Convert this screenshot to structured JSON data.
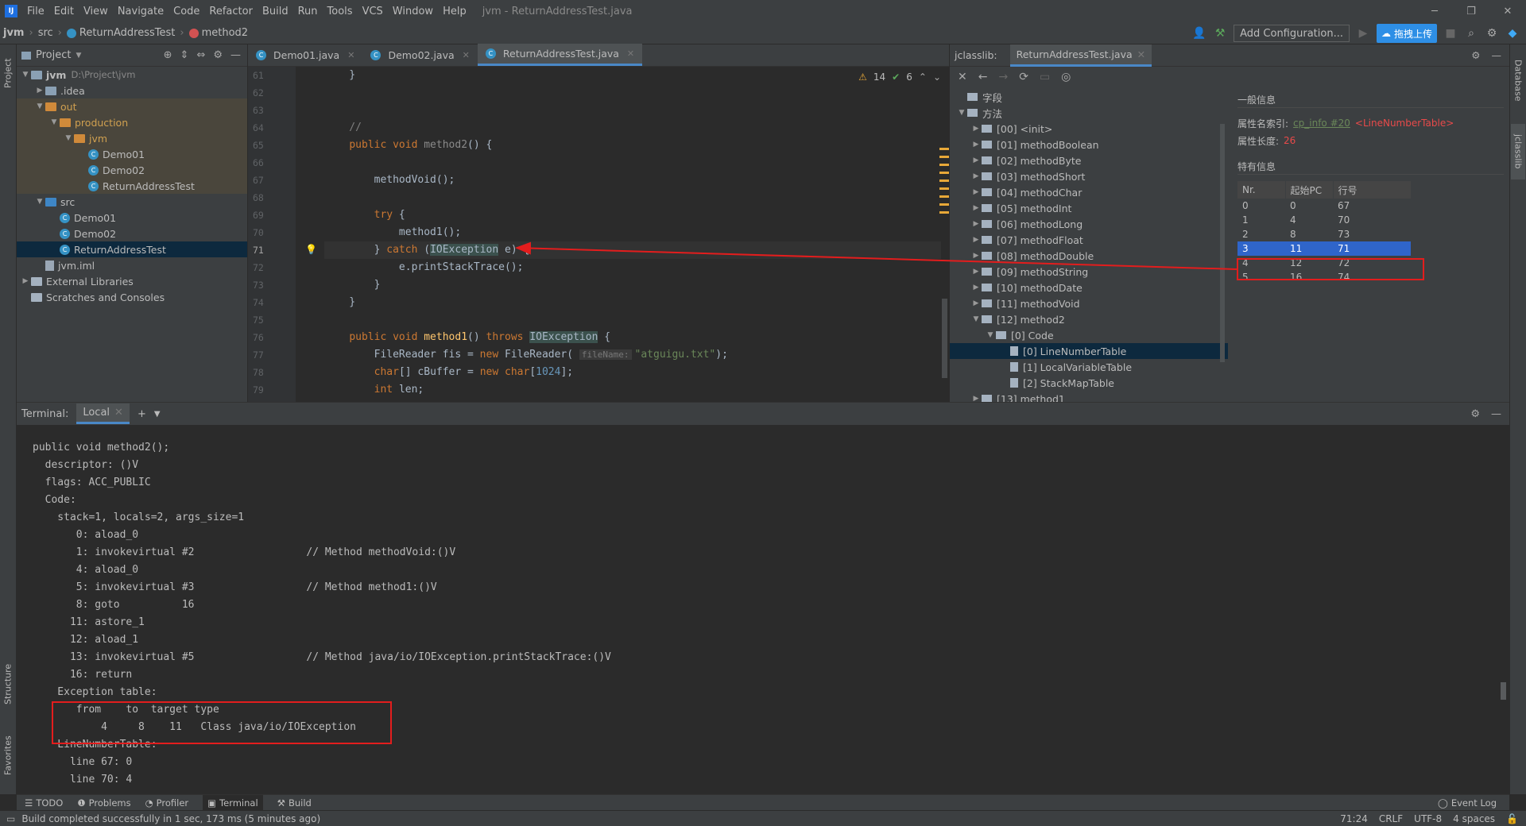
{
  "app": {
    "title": "jvm - ReturnAddressTest.java",
    "logo": "IJ"
  },
  "menu": [
    "File",
    "Edit",
    "View",
    "Navigate",
    "Code",
    "Refactor",
    "Build",
    "Run",
    "Tools",
    "VCS",
    "Window",
    "Help"
  ],
  "navbar": {
    "crumbs": [
      "jvm",
      "src",
      "ReturnAddressTest",
      "method2"
    ],
    "add_config": "Add Configuration...",
    "upload": "拖拽上传"
  },
  "project": {
    "header": "Project",
    "nodes": [
      {
        "label": "jvm",
        "extra": "D:\\Project\\jvm",
        "indent": 0,
        "arrow": "▼",
        "icon": "folder",
        "bold": true
      },
      {
        "label": ".idea",
        "indent": 1,
        "arrow": "▶",
        "icon": "folder"
      },
      {
        "label": "out",
        "indent": 1,
        "arrow": "▼",
        "icon": "folder-o",
        "zone": "out"
      },
      {
        "label": "production",
        "indent": 2,
        "arrow": "▼",
        "icon": "folder-o",
        "zone": "out"
      },
      {
        "label": "jvm",
        "indent": 3,
        "arrow": "▼",
        "icon": "folder-o",
        "zone": "out"
      },
      {
        "label": "Demo01",
        "indent": 4,
        "arrow": "",
        "icon": "class",
        "zone": "out"
      },
      {
        "label": "Demo02",
        "indent": 4,
        "arrow": "",
        "icon": "class",
        "zone": "out"
      },
      {
        "label": "ReturnAddressTest",
        "indent": 4,
        "arrow": "",
        "icon": "class",
        "zone": "out"
      },
      {
        "label": "src",
        "indent": 1,
        "arrow": "▼",
        "icon": "folder-b"
      },
      {
        "label": "Demo01",
        "indent": 2,
        "arrow": "",
        "icon": "class"
      },
      {
        "label": "Demo02",
        "indent": 2,
        "arrow": "",
        "icon": "class"
      },
      {
        "label": "ReturnAddressTest",
        "indent": 2,
        "arrow": "",
        "icon": "class",
        "selected": true
      },
      {
        "label": "jvm.iml",
        "indent": 1,
        "arrow": "",
        "icon": "file"
      },
      {
        "label": "External Libraries",
        "indent": 0,
        "arrow": "▶",
        "icon": "lib"
      },
      {
        "label": "Scratches and Consoles",
        "indent": 0,
        "arrow": "",
        "icon": "lib"
      }
    ]
  },
  "editor": {
    "tabs": [
      {
        "label": "Demo01.java"
      },
      {
        "label": "Demo02.java"
      },
      {
        "label": "ReturnAddressTest.java",
        "active": true
      }
    ],
    "warnings": "14",
    "ok": "6",
    "line_numbers": [
      "61",
      "62",
      "63",
      "64",
      "65",
      "66",
      "67",
      "68",
      "69",
      "70",
      "71",
      "72",
      "73",
      "74",
      "75",
      "76",
      "77",
      "78",
      "79"
    ],
    "lines": [
      [
        {
          "t": "    }"
        }
      ],
      [
        {
          "t": ""
        }
      ],
      [
        {
          "t": ""
        }
      ],
      [
        {
          "t": "    //",
          "c": "cm"
        }
      ],
      [
        {
          "t": "    "
        },
        {
          "t": "public void ",
          "c": "kw"
        },
        {
          "t": "method2",
          "c": "grayfn"
        },
        {
          "t": "() {"
        }
      ],
      [
        {
          "t": ""
        }
      ],
      [
        {
          "t": "        methodVoid();"
        }
      ],
      [
        {
          "t": ""
        }
      ],
      [
        {
          "t": "        "
        },
        {
          "t": "try",
          "c": "kw"
        },
        {
          "t": " {"
        }
      ],
      [
        {
          "t": "            method1();"
        }
      ],
      [
        {
          "t": "        } "
        },
        {
          "t": "catch",
          "c": "kw"
        },
        {
          "t": " ("
        },
        {
          "t": "IOException",
          "c": "hl"
        },
        {
          "t": " e) {"
        }
      ],
      [
        {
          "t": "            e.printStackTrace();"
        }
      ],
      [
        {
          "t": "        }"
        }
      ],
      [
        {
          "t": "    }"
        }
      ],
      [
        {
          "t": ""
        }
      ],
      [
        {
          "t": "    "
        },
        {
          "t": "public void ",
          "c": "kw"
        },
        {
          "t": "method1",
          "c": "mt"
        },
        {
          "t": "() "
        },
        {
          "t": "throws ",
          "c": "kw"
        },
        {
          "t": "IOException",
          "c": "hl"
        },
        {
          "t": " {"
        }
      ],
      [
        {
          "t": "        FileReader fis = "
        },
        {
          "t": "new ",
          "c": "kw"
        },
        {
          "t": "FileReader( "
        },
        {
          "t": "fileName:",
          "c": "hint"
        },
        {
          "t": "\"atguigu.txt\"",
          "c": "st"
        },
        {
          "t": ");"
        }
      ],
      [
        {
          "t": "        "
        },
        {
          "t": "char",
          "c": "kw"
        },
        {
          "t": "[] cBuffer = "
        },
        {
          "t": "new char",
          "c": "kw"
        },
        {
          "t": "["
        },
        {
          "t": "1024",
          "c": "num"
        },
        {
          "t": "];"
        }
      ],
      [
        {
          "t": "        "
        },
        {
          "t": "int ",
          "c": "kw"
        },
        {
          "t": "len;"
        }
      ]
    ],
    "current_line": "71"
  },
  "jclasslib": {
    "header": "jclasslib:",
    "file_tab": "ReturnAddressTest.java",
    "tree": [
      {
        "label": "字段",
        "indent": 0,
        "arrow": "",
        "icon": "folder"
      },
      {
        "label": "方法",
        "indent": 0,
        "arrow": "▼",
        "icon": "folder"
      },
      {
        "label": "[00] <init>",
        "indent": 1,
        "arrow": "▶",
        "icon": "folder"
      },
      {
        "label": "[01] methodBoolean",
        "indent": 1,
        "arrow": "▶",
        "icon": "folder"
      },
      {
        "label": "[02] methodByte",
        "indent": 1,
        "arrow": "▶",
        "icon": "folder"
      },
      {
        "label": "[03] methodShort",
        "indent": 1,
        "arrow": "▶",
        "icon": "folder"
      },
      {
        "label": "[04] methodChar",
        "indent": 1,
        "arrow": "▶",
        "icon": "folder"
      },
      {
        "label": "[05] methodInt",
        "indent": 1,
        "arrow": "▶",
        "icon": "folder"
      },
      {
        "label": "[06] methodLong",
        "indent": 1,
        "arrow": "▶",
        "icon": "folder"
      },
      {
        "label": "[07] methodFloat",
        "indent": 1,
        "arrow": "▶",
        "icon": "folder"
      },
      {
        "label": "[08] methodDouble",
        "indent": 1,
        "arrow": "▶",
        "icon": "folder"
      },
      {
        "label": "[09] methodString",
        "indent": 1,
        "arrow": "▶",
        "icon": "folder"
      },
      {
        "label": "[10] methodDate",
        "indent": 1,
        "arrow": "▶",
        "icon": "folder"
      },
      {
        "label": "[11] methodVoid",
        "indent": 1,
        "arrow": "▶",
        "icon": "folder"
      },
      {
        "label": "[12] method2",
        "indent": 1,
        "arrow": "▼",
        "icon": "folder"
      },
      {
        "label": "[0] Code",
        "indent": 2,
        "arrow": "▼",
        "icon": "folder"
      },
      {
        "label": "[0] LineNumberTable",
        "indent": 3,
        "arrow": "",
        "icon": "file",
        "selected": true
      },
      {
        "label": "[1] LocalVariableTable",
        "indent": 3,
        "arrow": "",
        "icon": "file"
      },
      {
        "label": "[2] StackMapTable",
        "indent": 3,
        "arrow": "",
        "icon": "file"
      },
      {
        "label": "[13] method1",
        "indent": 1,
        "arrow": "▶",
        "icon": "folder"
      }
    ],
    "general_info": "一般信息",
    "attr_name_label": "属性名索引:",
    "attr_name_link": "cp_info #20",
    "attr_name_value": "<LineNumberTable>",
    "attr_len_label": "属性长度:",
    "attr_len_value": "26",
    "specific_info": "特有信息",
    "table_headers": [
      "Nr.",
      "起始PC",
      "行号"
    ],
    "table_rows": [
      [
        "0",
        "0",
        "67"
      ],
      [
        "1",
        "4",
        "70"
      ],
      [
        "2",
        "8",
        "73"
      ],
      [
        "3",
        "11",
        "71"
      ],
      [
        "4",
        "12",
        "72"
      ],
      [
        "5",
        "16",
        "74"
      ]
    ],
    "selected_row": 3
  },
  "terminal": {
    "label": "Terminal:",
    "tab": "Local",
    "lines": [
      "public void method2();",
      "  descriptor: ()V",
      "  flags: ACC_PUBLIC",
      "  Code:",
      "    stack=1, locals=2, args_size=1",
      "       0: aload_0",
      "       1: invokevirtual #2                  // Method methodVoid:()V",
      "       4: aload_0",
      "       5: invokevirtual #3                  // Method method1:()V",
      "       8: goto          16",
      "      11: astore_1",
      "      12: aload_1",
      "      13: invokevirtual #5                  // Method java/io/IOException.printStackTrace:()V",
      "      16: return",
      "    Exception table:",
      "       from    to  target type",
      "           4     8    11   Class java/io/IOException",
      "    LineNumberTable:",
      "      line 67: 0",
      "      line 70: 4"
    ]
  },
  "bottom_tabs": [
    "TODO",
    "Problems",
    "Profiler",
    "Terminal",
    "Build"
  ],
  "event_log": "Event Log",
  "status": {
    "message": "Build completed successfully in 1 sec, 173 ms (5 minutes ago)",
    "position": "71:24",
    "line_sep": "CRLF",
    "encoding": "UTF-8",
    "indent": "4 spaces"
  },
  "side_tabs": {
    "left_top": "Project",
    "left_mid": "Structure",
    "left_bot": "Favorites",
    "right_top": "Database",
    "right_mid": "jclasslib"
  },
  "colors": {
    "accent": "#4a88c7",
    "highlight_box": "#e31d1d",
    "selection": "#2f65ca"
  }
}
